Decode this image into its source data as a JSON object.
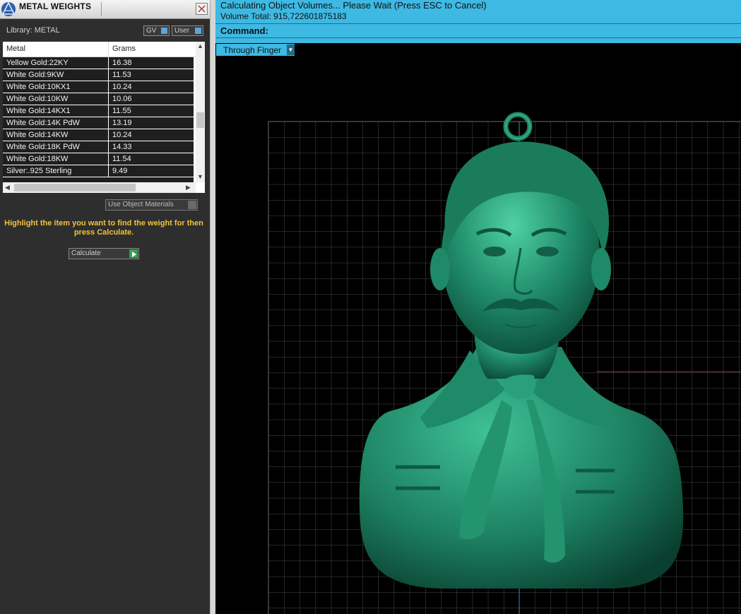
{
  "panel": {
    "title": "METAL WEIGHTS",
    "library_label": "Library: METAL",
    "toggles": {
      "gv": "GV",
      "user": "User"
    },
    "table": {
      "headers": [
        "Metal",
        "Grams"
      ],
      "rows": [
        {
          "metal": "Yellow Gold:22KY",
          "grams": "16.38"
        },
        {
          "metal": "White Gold:9KW",
          "grams": "11.53"
        },
        {
          "metal": "White Gold:10KX1",
          "grams": "10.24"
        },
        {
          "metal": "White Gold:10KW",
          "grams": "10.06"
        },
        {
          "metal": "White Gold:14KX1",
          "grams": "11.55"
        },
        {
          "metal": "White Gold:14K PdW",
          "grams": "13.19"
        },
        {
          "metal": "White Gold:14KW",
          "grams": "10.24"
        },
        {
          "metal": "White Gold:18K PdW",
          "grams": "14.33"
        },
        {
          "metal": "White Gold:18KW",
          "grams": "11.54"
        },
        {
          "metal": "Silver:.925 Sterling",
          "grams": "9.49"
        }
      ]
    },
    "use_object_materials": "Use Object Materials",
    "hint": "Highlight the item you want to find the weight for then press Calculate.",
    "calculate": "Calculate"
  },
  "status": {
    "line1": "Calculating Object Volumes... Please Wait (Press ESC to Cancel)",
    "line2": "Volume Total: 915,722601875183",
    "command_label": "Command:"
  },
  "viewport": {
    "view_mode": "Through Finger"
  },
  "colors": {
    "accent": "#3db9e3",
    "hint": "#f3c23a",
    "model": "#1f8a68",
    "grid": "#5a5a5a"
  }
}
